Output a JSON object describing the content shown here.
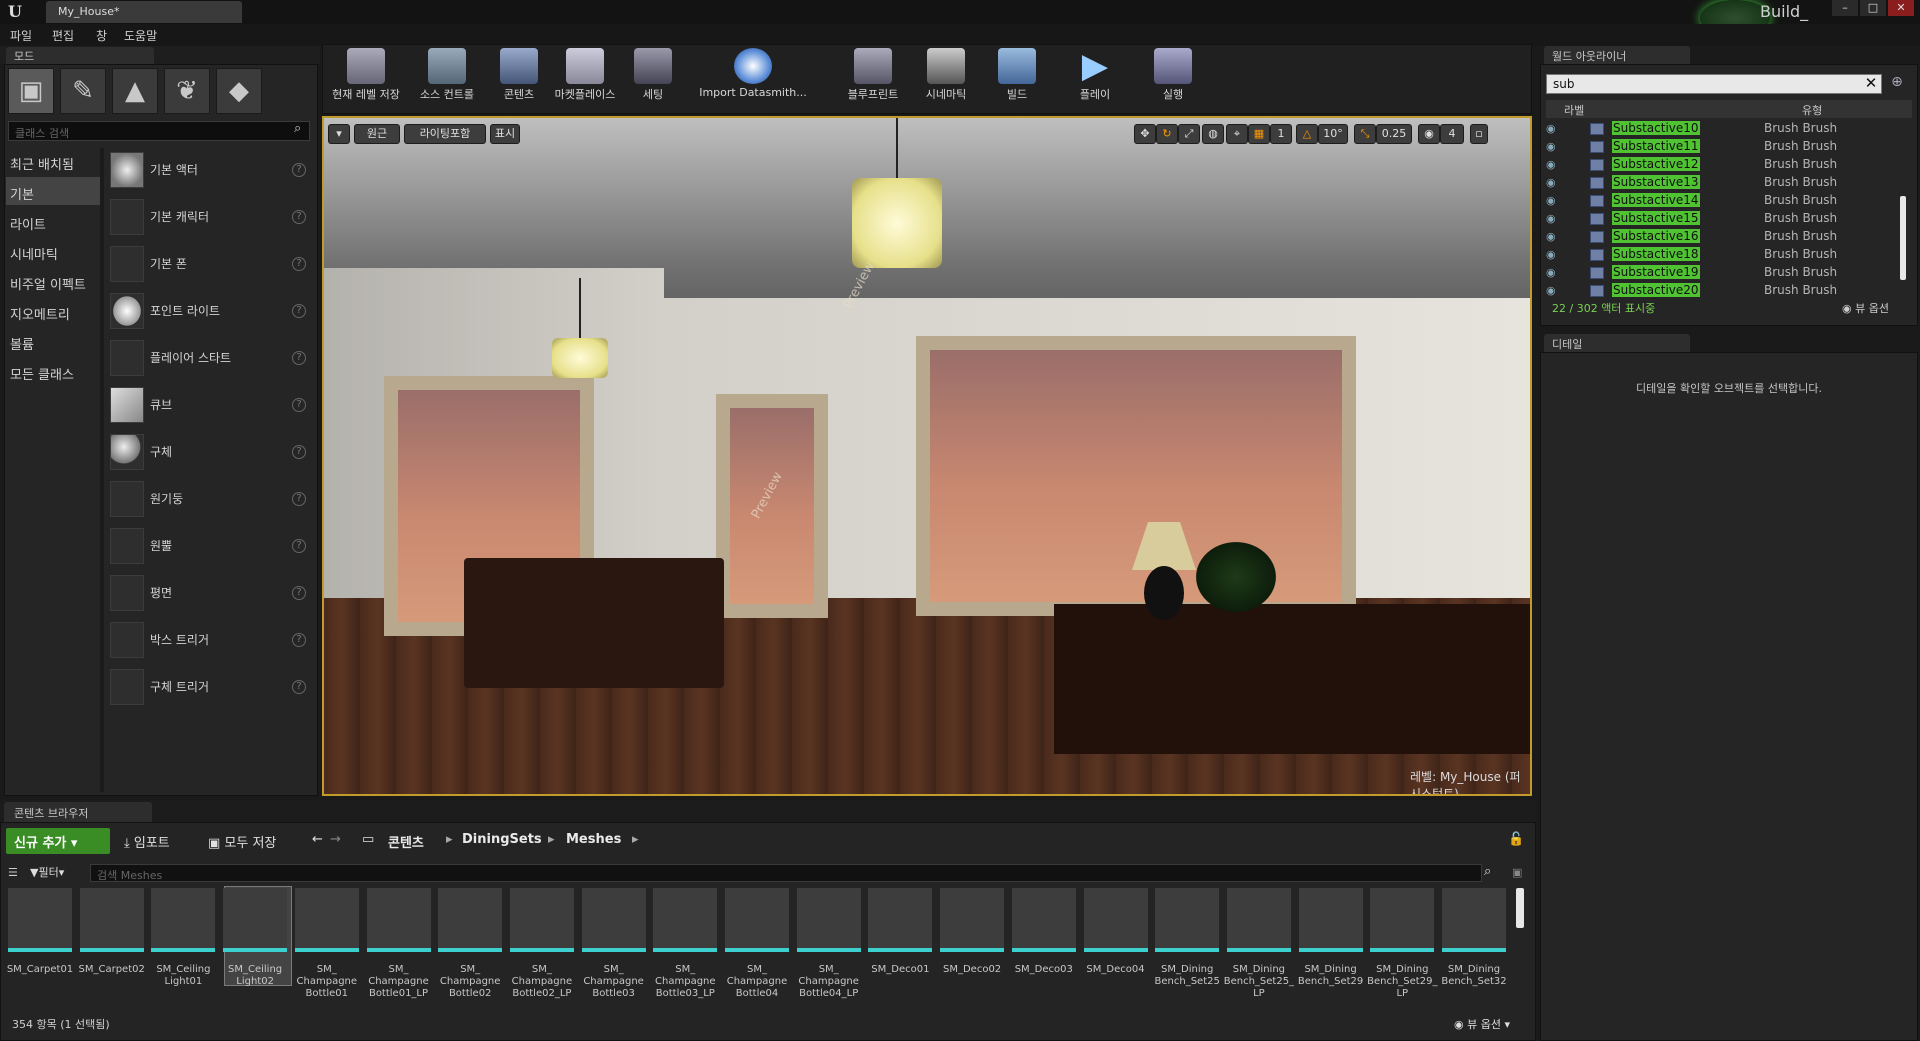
{
  "app": {
    "document_tab": "My_House*",
    "build_text": "Build_"
  },
  "menu": [
    "파일",
    "편집",
    "창",
    "도움말"
  ],
  "modes": {
    "tab_label": "모드",
    "search_placeholder": "클래스 검색",
    "categories": [
      "최근 배치됨",
      "기본",
      "라이트",
      "시네마틱",
      "비주얼 이펙트",
      "지오메트리",
      "볼륨",
      "모든 클래스"
    ],
    "selected_category": "기본",
    "place_items": [
      "기본 액터",
      "기본 캐릭터",
      "기본 폰",
      "포인트 라이트",
      "플레이어 스타트",
      "큐브",
      "구체",
      "원기둥",
      "원뿔",
      "평면",
      "박스 트리거",
      "구체 트리거"
    ]
  },
  "toolbar": {
    "buttons": [
      "현재 레벨 저장",
      "소스 컨트롤",
      "콘텐츠",
      "마켓플레이스",
      "세팅",
      "Import Datasmith...",
      "블루프린트",
      "시네마틱",
      "빌드",
      "플레이",
      "실행"
    ]
  },
  "viewport": {
    "perspective_label": "원근",
    "lighting_label": "라이팅포함",
    "show_label": "표시",
    "rotation_snap": "10°",
    "scale_snap": "0.25",
    "camera_speed": "4",
    "grid_snap": "1",
    "level_prefix": "레벨:",
    "level_name": "My_House (퍼시스턴트)",
    "watermark": "Preview"
  },
  "outliner": {
    "tab_label": "월드 아웃라이너",
    "search_value": "sub",
    "col_label": "라벨",
    "col_type": "유형",
    "rows": [
      {
        "name": "Substactive10",
        "type": "Brush Brush"
      },
      {
        "name": "Substactive11",
        "type": "Brush Brush"
      },
      {
        "name": "Substactive12",
        "type": "Brush Brush"
      },
      {
        "name": "Substactive13",
        "type": "Brush Brush"
      },
      {
        "name": "Substactive14",
        "type": "Brush Brush"
      },
      {
        "name": "Substactive15",
        "type": "Brush Brush"
      },
      {
        "name": "Substactive16",
        "type": "Brush Brush"
      },
      {
        "name": "Substactive18",
        "type": "Brush Brush"
      },
      {
        "name": "Substactive19",
        "type": "Brush Brush"
      },
      {
        "name": "Substactive20",
        "type": "Brush Brush"
      }
    ],
    "count_text": "22 / 302 액터 표시중",
    "view_options": "뷰 옵션"
  },
  "details": {
    "tab_label": "디테일",
    "empty_message": "디테일을 확인할 오브젝트를 선택합니다."
  },
  "content_browser": {
    "tab_label": "콘텐츠 브라우저",
    "add_new": "신규 추가",
    "import": "임포트",
    "save_all": "모두 저장",
    "breadcrumbs": [
      "콘텐츠",
      "DiningSets",
      "Meshes"
    ],
    "filter_label": "필터",
    "search_placeholder": "검색 Meshes",
    "assets": [
      "SM_Carpet01",
      "SM_Carpet02",
      "SM_Ceiling Light01",
      "SM_Ceiling Light02",
      "SM_ Champagne Bottle01",
      "SM_ Champagne Bottle01_LP",
      "SM_ Champagne Bottle02",
      "SM_ Champagne Bottle02_LP",
      "SM_ Champagne Bottle03",
      "SM_ Champagne Bottle03_LP",
      "SM_ Champagne Bottle04",
      "SM_ Champagne Bottle04_LP",
      "SM_Deco01",
      "SM_Deco02",
      "SM_Deco03",
      "SM_Deco04",
      "SM_Dining Bench_Set25",
      "SM_Dining Bench_Set25_ LP",
      "SM_Dining Bench_Set29",
      "SM_Dining Bench_Set29_ LP",
      "SM_Dining Bench_Set32"
    ],
    "footer": "354 항목 (1 선택됨)",
    "view_options": "뷰 옵션"
  }
}
